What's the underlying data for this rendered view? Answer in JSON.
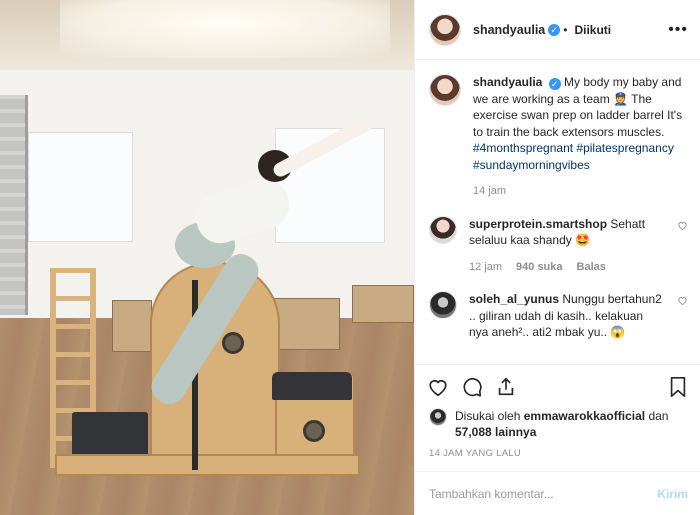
{
  "header": {
    "username": "shandyaulia",
    "follow_dot": "•",
    "follow_status": "Diikuti",
    "more": "•••"
  },
  "caption": {
    "username": "shandyaulia",
    "text": "My body my baby and we are working as a team 👮 The exercise swan prep on ladder barrel It's to train the back extensors muscles.",
    "hashtags": [
      "#4monthspregnant",
      "#pilatespregnancy",
      "#sundaymorningvibes"
    ],
    "time": "14 jam"
  },
  "comments": [
    {
      "username": "superprotein.smartshop",
      "text": "Sehatt selaluu kaa shandy 🤩",
      "time": "12 jam",
      "likes": "940 suka",
      "reply": "Balas"
    },
    {
      "username": "soleh_al_yunus",
      "text": "Nunggu bertahun2 .. giliran udah di kasih.. kelakuan nya aneh².. ati2 mbak yu.. 😱",
      "time": "",
      "likes": "",
      "reply": ""
    }
  ],
  "likes": {
    "prefix": "Disukai oleh",
    "liker": "emmawarokkaofficial",
    "and": "dan",
    "count": "57,088 lainnya"
  },
  "timestamp": "14 JAM YANG LALU",
  "add_comment": {
    "placeholder": "Tambahkan komentar...",
    "send": "Kirim"
  },
  "colors": {
    "verified": "#3897f0",
    "hashtag": "#003569",
    "send_disabled": "#b3dbff",
    "muted": "#8e8e8e"
  },
  "icons": [
    "heart-icon",
    "comment-icon",
    "share-icon",
    "bookmark-icon",
    "verified-badge-icon",
    "more-options-icon"
  ]
}
